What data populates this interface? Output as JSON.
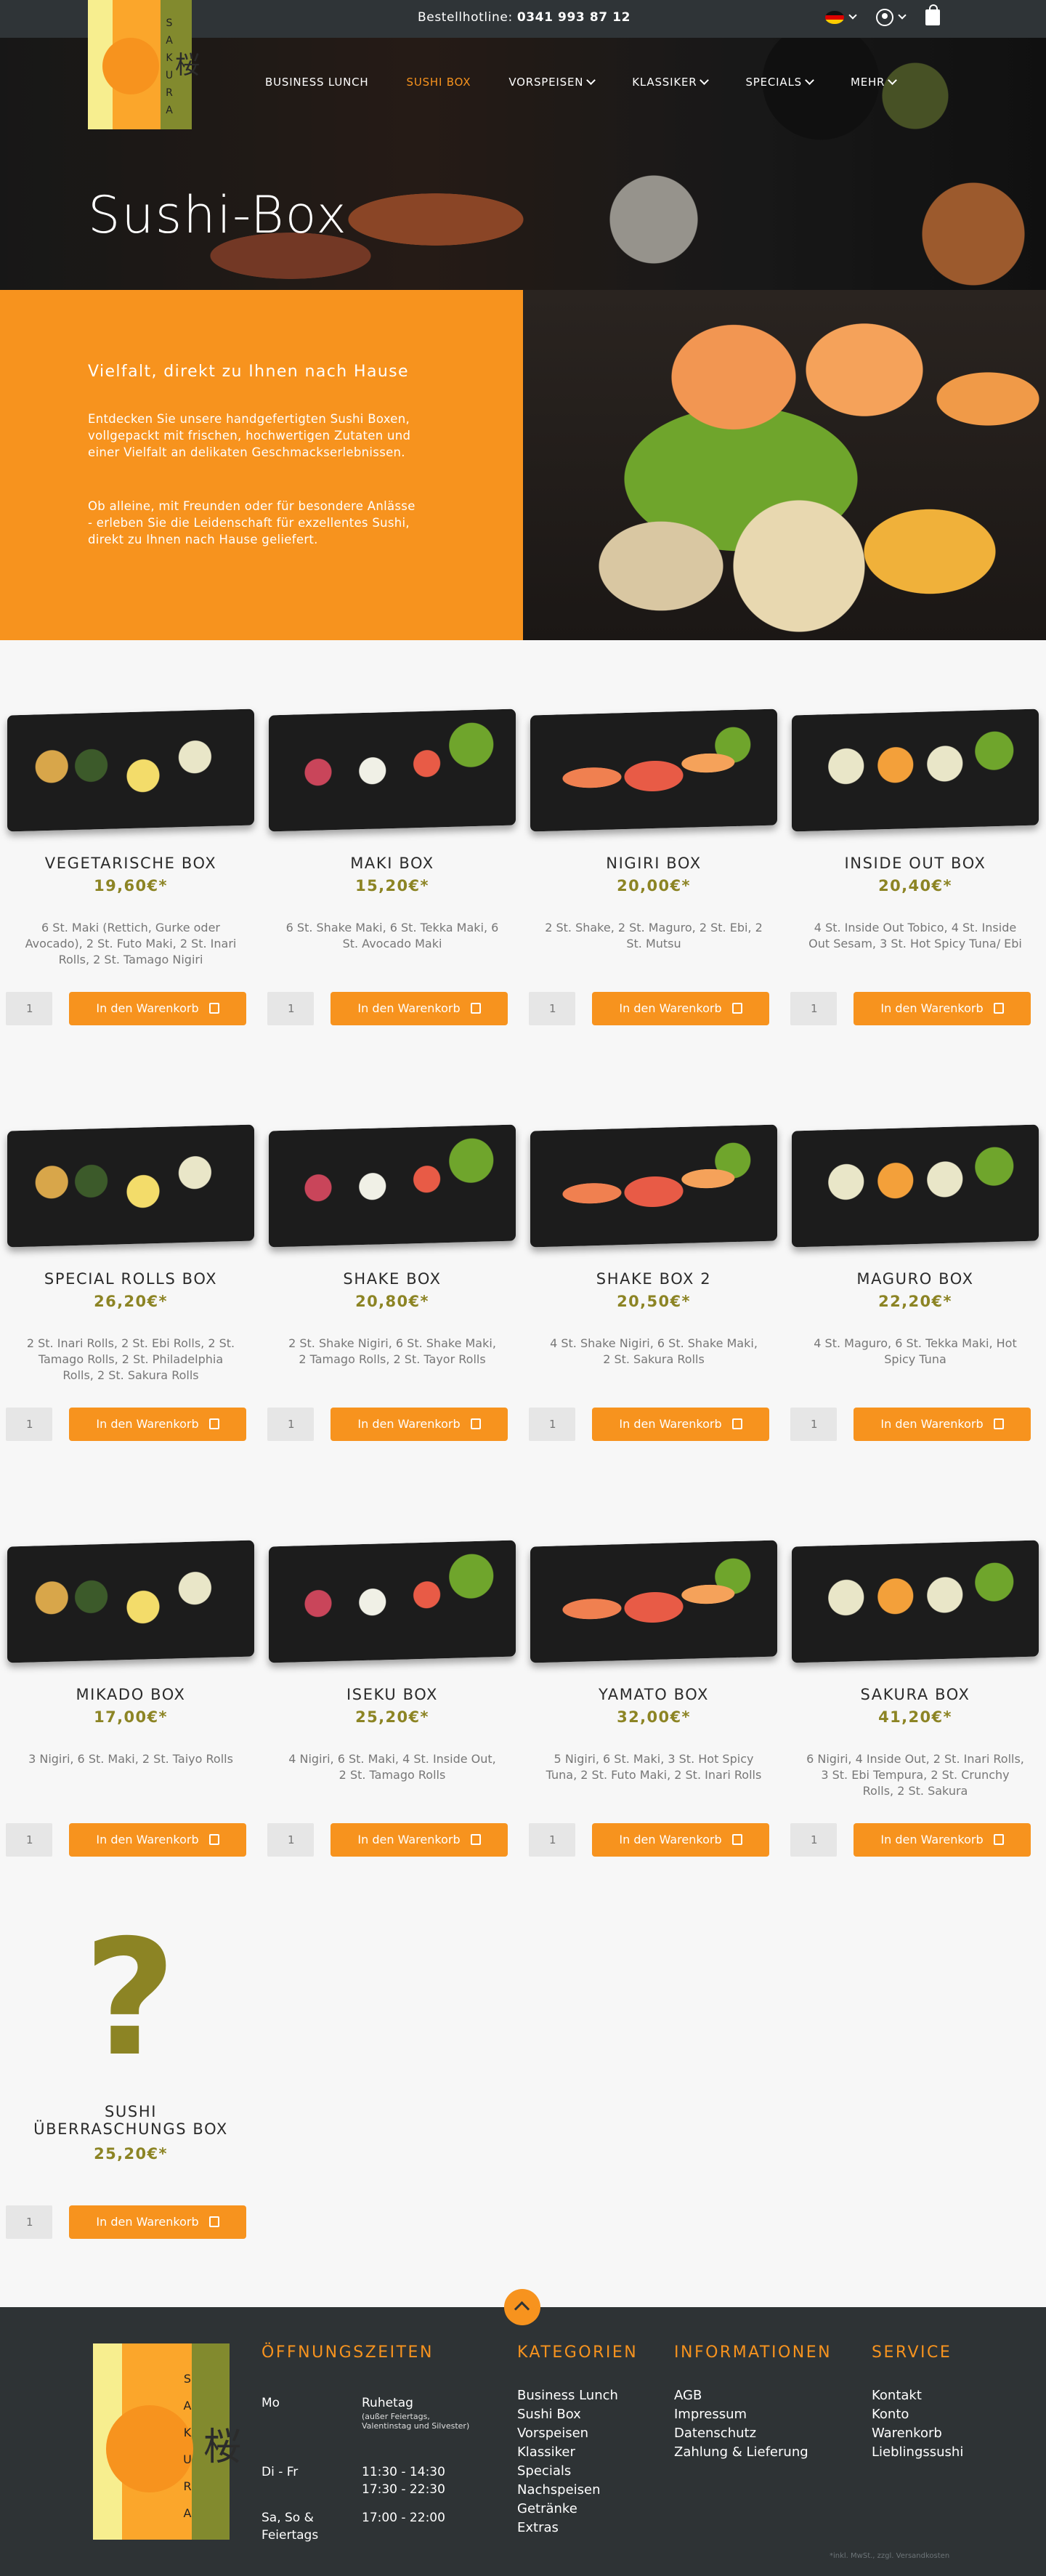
{
  "topbar": {
    "hotline_label": "Bestellhotline:",
    "hotline_number": "0341 993 87 12",
    "icons": [
      "flag-de-icon",
      "user-icon",
      "bag-icon"
    ]
  },
  "brand": {
    "kanji": "桜",
    "letters": [
      "S",
      "A",
      "K",
      "U",
      "R",
      "A"
    ]
  },
  "nav": {
    "items": [
      "BUSINESS LUNCH",
      "SUSHI BOX",
      "VORSPEISEN",
      "KLASSIKER",
      "SPECIALS",
      "MEHR"
    ]
  },
  "hero": {
    "title": "Sushi-Box"
  },
  "intro": {
    "heading": "Vielfalt, direkt zu Ihnen nach Hause",
    "p1": "Entdecken Sie unsere handgefertigten Sushi Boxen, vollgepackt mit frischen, hochwertigen Zutaten und einer Vielfalt an delikaten Geschmackserlebnissen.",
    "p2": "Ob alleine, mit Freunden oder für besondere Anlässe - erleben Sie die Leidenschaft für exzellentes Sushi, direkt zu Ihnen nach Hause geliefert."
  },
  "cart_label": "In den Warenkorb",
  "products": [
    {
      "name": "VEGETARISCHE BOX",
      "price": "19,60€*",
      "desc": "6 St. Maki (Rettich, Gurke oder Avocado), 2 St. Futo Maki, 2 St. Inari Rolls, 2 St. Tamago Nigiri",
      "qty": "1"
    },
    {
      "name": "MAKI BOX",
      "price": "15,20€*",
      "desc": "6 St. Shake Maki, 6 St. Tekka Maki, 6 St. Avocado Maki",
      "qty": "1"
    },
    {
      "name": "NIGIRI BOX",
      "price": "20,00€*",
      "desc": "2 St. Shake, 2 St. Maguro, 2 St. Ebi, 2 St. Mutsu",
      "qty": "1"
    },
    {
      "name": "INSIDE OUT BOX",
      "price": "20,40€*",
      "desc": "4 St. Inside Out Tobico, 4 St. Inside Out Sesam, 3 St. Hot Spicy Tuna/ Ebi",
      "qty": "1"
    },
    {
      "name": "SPECIAL ROLLS BOX",
      "price": "26,20€*",
      "desc": "2 St. Inari Rolls, 2 St. Ebi Rolls, 2 St. Tamago Rolls, 2 St. Philadelphia Rolls, 2 St. Sakura Rolls",
      "qty": "1"
    },
    {
      "name": "SHAKE BOX",
      "price": "20,80€*",
      "desc": "2 St. Shake Nigiri, 6 St. Shake Maki, 2 Tamago Rolls, 2 St. Tayor Rolls",
      "qty": "1"
    },
    {
      "name": "SHAKE BOX 2",
      "price": "20,50€*",
      "desc": "4 St. Shake Nigiri, 6 St. Shake Maki, 2 St. Sakura Rolls",
      "qty": "1"
    },
    {
      "name": "MAGURO BOX",
      "price": "22,20€*",
      "desc": "4 St. Maguro, 6 St. Tekka Maki, Hot Spicy Tuna",
      "qty": "1"
    },
    {
      "name": "MIKADO BOX",
      "price": "17,00€*",
      "desc": "3 Nigiri, 6 St. Maki, 2 St. Taiyo Rolls",
      "qty": "1"
    },
    {
      "name": "ISEKU BOX",
      "price": "25,20€*",
      "desc": "4 Nigiri, 6 St. Maki, 4 St. Inside Out, 2 St. Tamago Rolls",
      "qty": "1"
    },
    {
      "name": "YAMATO BOX",
      "price": "32,00€*",
      "desc": "5 Nigiri, 6 St. Maki, 3 St. Hot Spicy Tuna, 2 St. Futo Maki, 2 St. Inari Rolls",
      "qty": "1"
    },
    {
      "name": "SAKURA BOX",
      "price": "41,20€*",
      "desc": "6 Nigiri, 4 Inside Out, 2 St. Inari Rolls, 3 St. Ebi Tempura, 2 St. Crunchy Rolls, 2 St. Sakura",
      "qty": "1"
    }
  ],
  "surprise": {
    "name_line1": "SUSHI",
    "name_line2": "ÜBERRASCHUNGS BOX",
    "price": "25,20€*",
    "qty": "1",
    "symbol": "?"
  },
  "footer": {
    "hours_title": "ÖFFNUNGSZEITEN",
    "hours": [
      {
        "day": "Mo",
        "time": "Ruhetag",
        "note": "(außer Feiertags, Valentinstag und Silvester)"
      },
      {
        "day": "Di - Fr",
        "time": "11:30 - 14:30",
        "time2": "17:30 - 22:30"
      },
      {
        "day": "Sa, So & Feiertags",
        "time": "17:00 - 22:00"
      }
    ],
    "categories_title": "KATEGORIEN",
    "categories": [
      "Business Lunch",
      "Sushi Box",
      "Vorspeisen",
      "Klassiker",
      "Specials",
      "Nachspeisen",
      "Getränke",
      "Extras"
    ],
    "info_title": "INFORMATIONEN",
    "info": [
      "AGB",
      "Impressum",
      "Datenschutz",
      "Zahlung & Lieferung"
    ],
    "service_title": "SERVICE",
    "service": [
      "Kontakt",
      "Konto",
      "Warenkorb",
      "Lieblingssushi"
    ],
    "copyright": "*inkl. MwSt., zzgl. Versandkosten"
  },
  "colors": {
    "accent": "#f7931e",
    "olive": "#8c8424",
    "footer_bg": "#2e3335",
    "topbar_bg": "#2f3437"
  }
}
